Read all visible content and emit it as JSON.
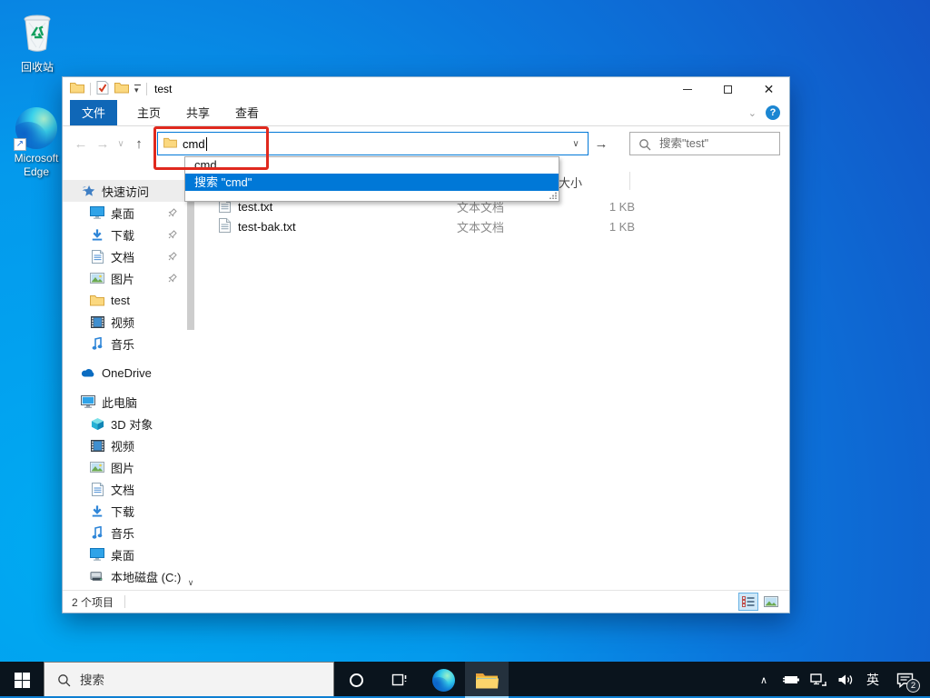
{
  "colors": {
    "accent": "#0078d7",
    "file_tab_blue": "#1067b7",
    "annotation_red": "#e0291e",
    "dropdown_selection": "#0078d7"
  },
  "desktop": {
    "recycle_bin_label": "回收站",
    "edge_label": "Microsoft Edge"
  },
  "window": {
    "title": "test",
    "caption": {
      "minimize": "",
      "maximize": "",
      "close": "✕"
    },
    "tabs": [
      {
        "label": "文件",
        "active": true
      },
      {
        "label": "主页",
        "active": false
      },
      {
        "label": "共享",
        "active": false
      },
      {
        "label": "查看",
        "active": false
      }
    ],
    "address": {
      "value": "cmd",
      "suggestions": [
        {
          "label": "cmd",
          "selected": false
        },
        {
          "label": "搜索 \"cmd\"",
          "selected": true
        }
      ]
    },
    "search": {
      "placeholder": "搜索\"test\""
    },
    "list": {
      "columns": {
        "size": "大小"
      },
      "rows": [
        {
          "name": "test.txt",
          "type": "文本文档",
          "size": "1 KB"
        },
        {
          "name": "test-bak.txt",
          "type": "文本文档",
          "size": "1 KB"
        }
      ]
    },
    "sidebar": {
      "quick_access_label": "快速访问",
      "quick_items": [
        {
          "label": "桌面",
          "pinned": true
        },
        {
          "label": "下载",
          "pinned": true
        },
        {
          "label": "文档",
          "pinned": true
        },
        {
          "label": "图片",
          "pinned": true
        },
        {
          "label": "test",
          "pinned": false
        },
        {
          "label": "视频",
          "pinned": false
        },
        {
          "label": "音乐",
          "pinned": false
        }
      ],
      "onedrive_label": "OneDrive",
      "this_pc_label": "此电脑",
      "pc_items": [
        {
          "label": "3D 对象"
        },
        {
          "label": "视频"
        },
        {
          "label": "图片"
        },
        {
          "label": "文档"
        },
        {
          "label": "下载"
        },
        {
          "label": "音乐"
        },
        {
          "label": "桌面"
        },
        {
          "label": "本地磁盘 (C:)"
        }
      ]
    },
    "statusbar": {
      "items_count": "2 个项目"
    }
  },
  "taskbar": {
    "search_placeholder": "搜索",
    "ime_indicator": "英",
    "notification_count": "2"
  },
  "icons": {
    "quick_access": "star-icon",
    "desktop_item": "monitor-icon",
    "downloads": "down-arrow-icon",
    "documents": "document-icon",
    "pictures": "picture-icon",
    "folder": "yellow-folder-icon",
    "videos": "film-icon",
    "music": "music-note-icon",
    "onedrive": "cloud-icon",
    "this_pc": "computer-icon",
    "objects_3d": "cube-icon",
    "local_disk": "drive-icon",
    "search": "magnifier-icon",
    "help": "question-icon"
  }
}
